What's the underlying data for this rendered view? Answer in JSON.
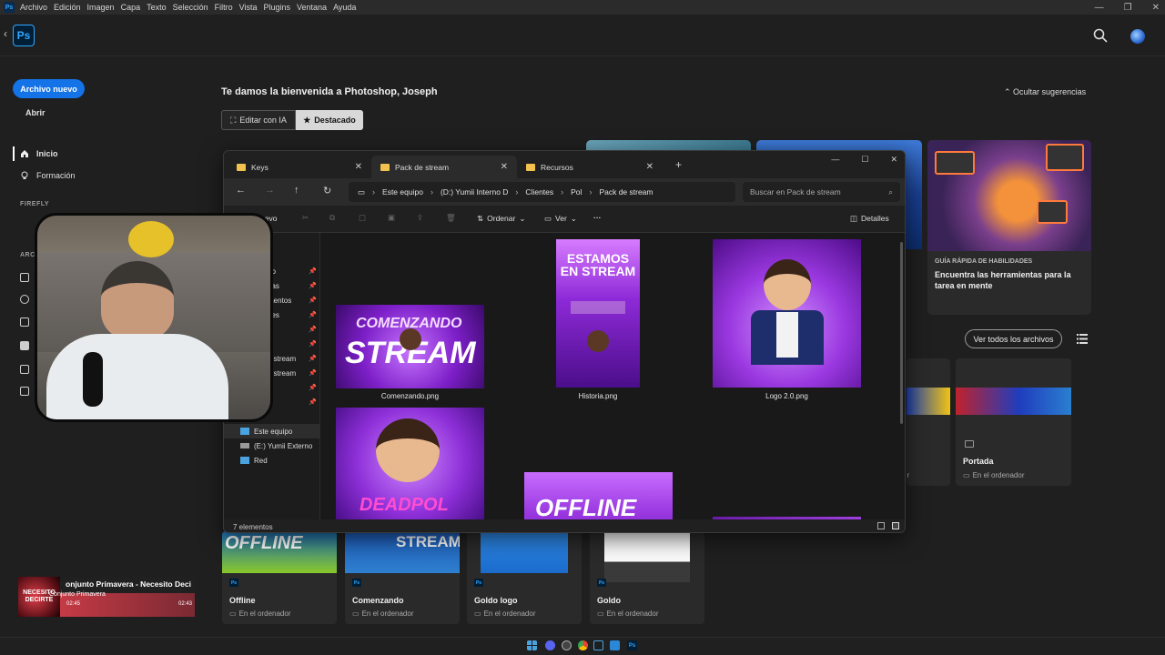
{
  "menubar": {
    "app_badge": "Ps",
    "items": [
      "Archivo",
      "Edición",
      "Imagen",
      "Capa",
      "Texto",
      "Selección",
      "Filtro",
      "Vista",
      "Plugins",
      "Ventana",
      "Ayuda"
    ],
    "window_controls": [
      "—",
      "❐",
      "✕"
    ]
  },
  "header": {
    "logo": "Ps",
    "back": "‹"
  },
  "sidebar": {
    "new_file": "Archivo nuevo",
    "open": "Abrir",
    "home": "Inicio",
    "learn": "Formación",
    "section_firefly": "FIREFLY",
    "section_files": "ARC"
  },
  "main": {
    "welcome": "Te damos la bienvenida a Photoshop, Joseph",
    "hide_suggestions": "Ocultar sugerencias",
    "tab_ai": "Editar con IA",
    "tab_featured": "Destacado",
    "guide_kicker": "GUÍA RÁPIDA DE HABILIDADES",
    "guide_title": "Encuentra las herramientas para la tarea en mente",
    "view_all": "Ver todos los archivos",
    "partial_loc_1": "r",
    "partial_loc_2": "or"
  },
  "recent_files": [
    {
      "name": "Offline",
      "location": "En el ordenador",
      "thumb_text": "OFFLINE"
    },
    {
      "name": "Comenzando",
      "location": "En el ordenador",
      "thumb_text": "STREAM"
    },
    {
      "name": "Goldo logo",
      "location": "En el ordenador",
      "thumb_text": ""
    },
    {
      "name": "Goldo",
      "location": "En el ordenador",
      "thumb_text": ""
    },
    {
      "name": "Portada",
      "location": "En el ordenador",
      "thumb_text": ""
    }
  ],
  "explorer": {
    "tabs": [
      "Keys",
      "Pack de stream",
      "Recursos"
    ],
    "tab_close": "✕",
    "new_tab": "+",
    "breadcrumb": [
      "Este equipo",
      "(D:) Yumii Interno D",
      "Clientes",
      "Pol",
      "Pack de stream"
    ],
    "search_placeholder": "Buscar en Pack de stream",
    "cmd": {
      "new": "uevo",
      "sort": "Ordenar",
      "view": "Ver",
      "more": "···",
      "details": "Detalles"
    },
    "nav_items": [
      "rio",
      "gas",
      "mentos",
      "nes",
      "a",
      "",
      "e stream",
      "e stream",
      "",
      ""
    ],
    "nav_bottom": [
      "Este equipo",
      "(E:) Yumii Externo",
      "Red"
    ],
    "files": [
      {
        "name": "Comenzando.png",
        "text": "STREAM",
        "sub": "COMENZANDO"
      },
      {
        "name": "Historia.png",
        "text": "ESTAMOS EN STREAM"
      },
      {
        "name": "Logo 2.0.png"
      },
      {
        "name": "",
        "text": "DEADPOL"
      },
      {
        "name": "",
        "text": "OFFLINE"
      }
    ],
    "status": "7 elementos"
  },
  "music": {
    "title": "onjunto Primavera - Necesito Deci",
    "artist": "Conjunto Primavera",
    "art_text": "NECESITO DECIRTE",
    "time_elapsed": "02:45",
    "time_total": "02:43"
  },
  "colors": {
    "accent": "#1473e6",
    "ps_blue": "#31a8ff",
    "bg": "#1f1f1f",
    "purple": "#9b3fd6"
  }
}
